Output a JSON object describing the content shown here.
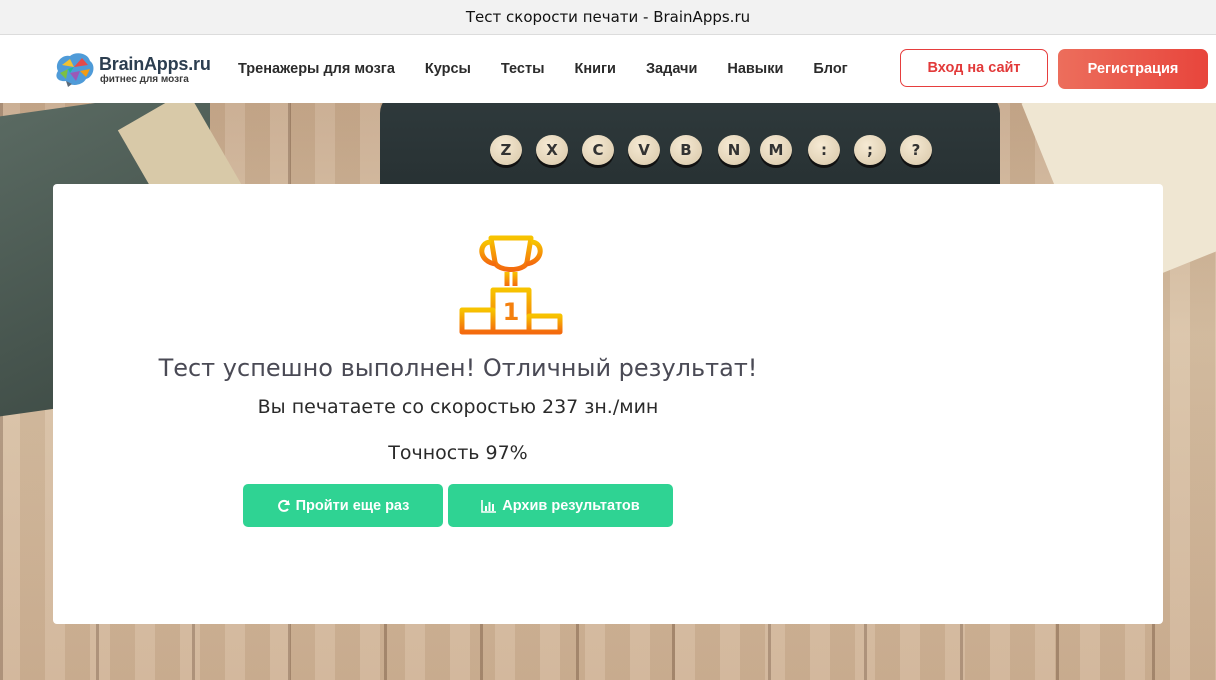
{
  "window": {
    "title": "Тест скорости печати - BrainApps.ru"
  },
  "header": {
    "logo": {
      "name": "BrainApps.ru",
      "tagline": "фитнес для мозга",
      "icon": "brain-icon"
    },
    "nav": [
      {
        "label": "Тренажеры для мозга"
      },
      {
        "label": "Курсы"
      },
      {
        "label": "Тесты"
      },
      {
        "label": "Книги"
      },
      {
        "label": "Задачи"
      },
      {
        "label": "Навыки"
      },
      {
        "label": "Блог"
      }
    ],
    "login_label": "Вход на сайт",
    "register_label": "Регистрация"
  },
  "background": {
    "keys": [
      "Z",
      "X",
      "C",
      "V",
      "B",
      "N",
      "M",
      ":",
      ";",
      "?"
    ]
  },
  "result": {
    "icon": "trophy-icon",
    "place": "1",
    "title": "Тест успешно выполнен! Отличный результат!",
    "speed_text": "Вы печатаете со скоростью 237 зн./мин",
    "accuracy_text": "Точность 97%",
    "retry_label": "Пройти еще раз",
    "retry_icon": "refresh-icon",
    "archive_label": "Архив результатов",
    "archive_icon": "bar-chart-icon"
  },
  "colors": {
    "accent_green": "#2fd393",
    "brand_red": "#e63e3e",
    "trophy_gold": "#f5b800",
    "trophy_orange": "#f46a0e"
  }
}
